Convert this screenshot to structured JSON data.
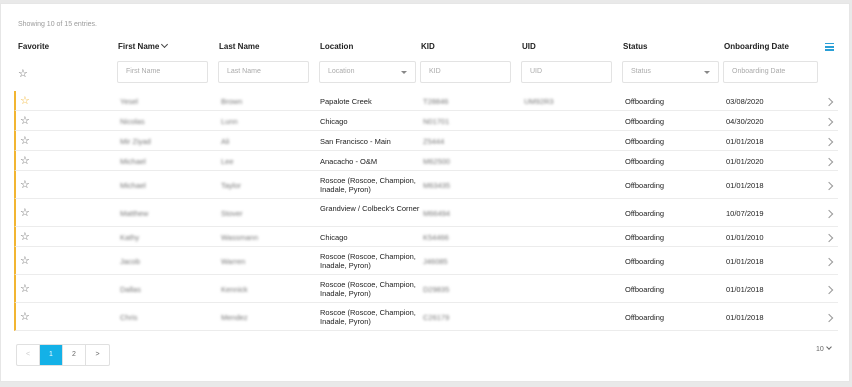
{
  "status_text": "Showing 10 of 15 entries.",
  "columns": [
    "Favorite",
    "First Name",
    "Last Name",
    "Location",
    "KID",
    "UID",
    "Status",
    "Onboarding Date"
  ],
  "filters": {
    "first_name": "First Name",
    "last_name": "Last Name",
    "location": "Location",
    "kid": "KID",
    "uid": "UID",
    "status": "Status",
    "onboarding_date": "Onboarding Date"
  },
  "rows": [
    {
      "favorite": true,
      "first": "Yesel",
      "last": "Brown",
      "location": "Papalote Creek",
      "kid": "T28846",
      "uid": "UM92R3",
      "status": "Offboarding",
      "date": "03/08/2020"
    },
    {
      "favorite": false,
      "first": "Nicolas",
      "last": "Lunn",
      "location": "Chicago",
      "kid": "N01701",
      "uid": "",
      "status": "Offboarding",
      "date": "04/30/2020"
    },
    {
      "favorite": false,
      "first": "Mir Ziyad",
      "last": "Ali",
      "location": "San Francisco - Main",
      "kid": "Z5444",
      "uid": "",
      "status": "Offboarding",
      "date": "01/01/2018"
    },
    {
      "favorite": false,
      "first": "Michael",
      "last": "Lee",
      "location": "Anacacho - O&M",
      "kid": "M62500",
      "uid": "",
      "status": "Offboarding",
      "date": "01/01/2020"
    },
    {
      "favorite": false,
      "first": "Michael",
      "last": "Taylor",
      "location": "Roscoe (Roscoe, Champion, Inadale, Pyron)",
      "kid": "M63435",
      "uid": "",
      "status": "Offboarding",
      "date": "01/01/2018"
    },
    {
      "favorite": false,
      "first": "Matthew",
      "last": "Stover",
      "location": "Grandview / Colbeck's Corner",
      "kid": "M66494",
      "uid": "",
      "status": "Offboarding",
      "date": "10/07/2019"
    },
    {
      "favorite": false,
      "first": "Kathy",
      "last": "Wassmann",
      "location": "Chicago",
      "kid": "K54466",
      "uid": "",
      "status": "Offboarding",
      "date": "01/01/2010"
    },
    {
      "favorite": false,
      "first": "Jacob",
      "last": "Warren",
      "location": "Roscoe (Roscoe, Champion, Inadale, Pyron)",
      "kid": "J46085",
      "uid": "",
      "status": "Offboarding",
      "date": "01/01/2018"
    },
    {
      "favorite": false,
      "first": "Dallas",
      "last": "Kennick",
      "location": "Roscoe (Roscoe, Champion, Inadale, Pyron)",
      "kid": "D29835",
      "uid": "",
      "status": "Offboarding",
      "date": "01/01/2018"
    },
    {
      "favorite": false,
      "first": "Chris",
      "last": "Mendez",
      "location": "Roscoe (Roscoe, Champion, Inadale, Pyron)",
      "kid": "C26179",
      "uid": "",
      "status": "Offboarding",
      "date": "01/01/2018"
    }
  ],
  "pagination": {
    "prev": "<",
    "pages": [
      "1",
      "2"
    ],
    "next": ">",
    "active": "1",
    "page_size": "10"
  },
  "colors": {
    "accent": "#14b1e7",
    "favorite": "#f2b531",
    "menu": "#2a9fd6"
  },
  "icons": {
    "favorite": "star-icon",
    "row_action": "chevron-right-icon",
    "column_menu": "hamburger-menu-icon"
  }
}
